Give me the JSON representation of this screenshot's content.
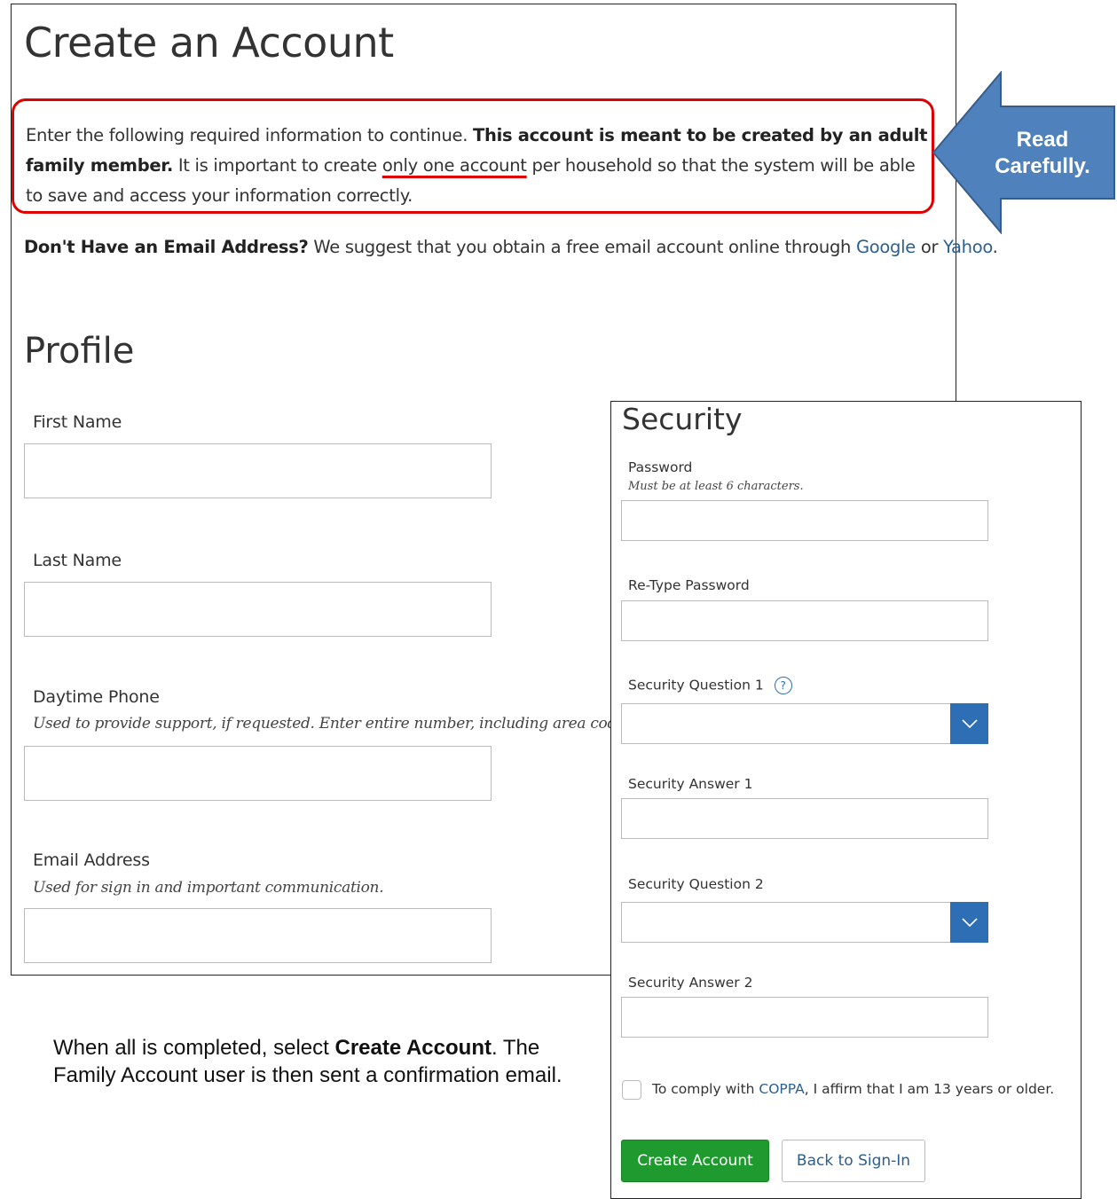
{
  "main": {
    "title": "Create an Account",
    "intro": {
      "part1": "Enter the following required information to continue. ",
      "bold": "This account is meant to be created by an adult family member.",
      "part2": " It is important to create ",
      "underlined": "only one account",
      "part3": " per household so that the system will be able to save and access your information correctly."
    },
    "no_email": {
      "bold": "Don't Have an Email Address?",
      "text": " We suggest that you obtain a free email account online through ",
      "link1": "Google",
      "or": " or ",
      "link2": "Yahoo",
      "end": "."
    },
    "profile_title": "Profile",
    "fields": {
      "first_name": "First Name",
      "last_name": "Last Name",
      "phone": "Daytime Phone",
      "phone_help": "Used to provide support, if requested. Enter entire number, including area code.",
      "email": "Email Address",
      "email_help": "Used for sign in and important communication."
    }
  },
  "callout": {
    "line1": "Read",
    "line2": "Carefully.",
    "color": "#4f81bd"
  },
  "instructions": {
    "part1": "When all is completed, select ",
    "bold": "Create Account",
    "part2": ". The Family Account user is then sent a confirmation email."
  },
  "security": {
    "title": "Security",
    "password": "Password",
    "password_help": "Must be at least 6 characters.",
    "retype": "Re-Type Password",
    "question1": "Security Question 1",
    "help_glyph": "?",
    "answer1": "Security Answer 1",
    "question2": "Security Question 2",
    "answer2": "Security Answer 2",
    "coppa_pre": "To comply with ",
    "coppa_link": "COPPA",
    "coppa_post": ", I affirm that I am 13 years or older.",
    "create_button": "Create Account",
    "back_button": "Back to Sign-In",
    "accent": "#2e6eb5",
    "button_color": "#1f9a2e"
  }
}
